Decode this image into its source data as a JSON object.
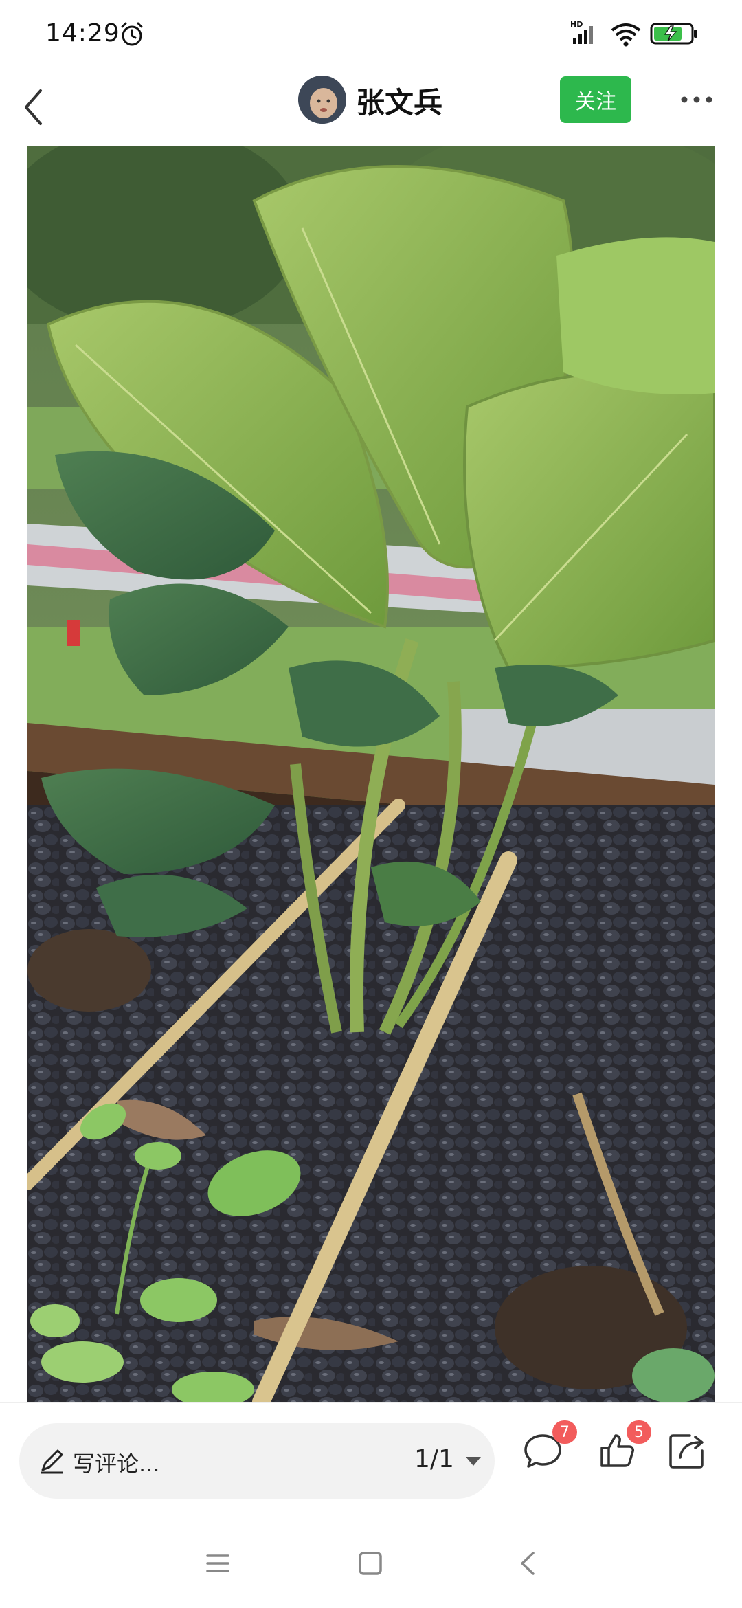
{
  "status_bar": {
    "time": "14:29",
    "icons": [
      "alarm-icon",
      "hd-signal-icon",
      "wifi-icon",
      "battery-charging-icon"
    ]
  },
  "header": {
    "back_icon": "chevron-left-icon",
    "username": "张文兵",
    "follow_label": "关注",
    "more_icon": "more-dots-icon"
  },
  "photo": {
    "icon": "photo-strawberry-plant"
  },
  "comment_bar": {
    "placeholder": "写评论...",
    "page_counter": "1/1",
    "comment_count": "7",
    "like_count": "5",
    "share_icon": "share-icon"
  },
  "nav_bar": {
    "icons": [
      "menu-icon",
      "home-square-icon",
      "back-triangle-icon"
    ]
  },
  "colors": {
    "follow_green": "#2db84d",
    "badge_red": "#f25c5c",
    "input_bg": "#f2f2f2"
  }
}
